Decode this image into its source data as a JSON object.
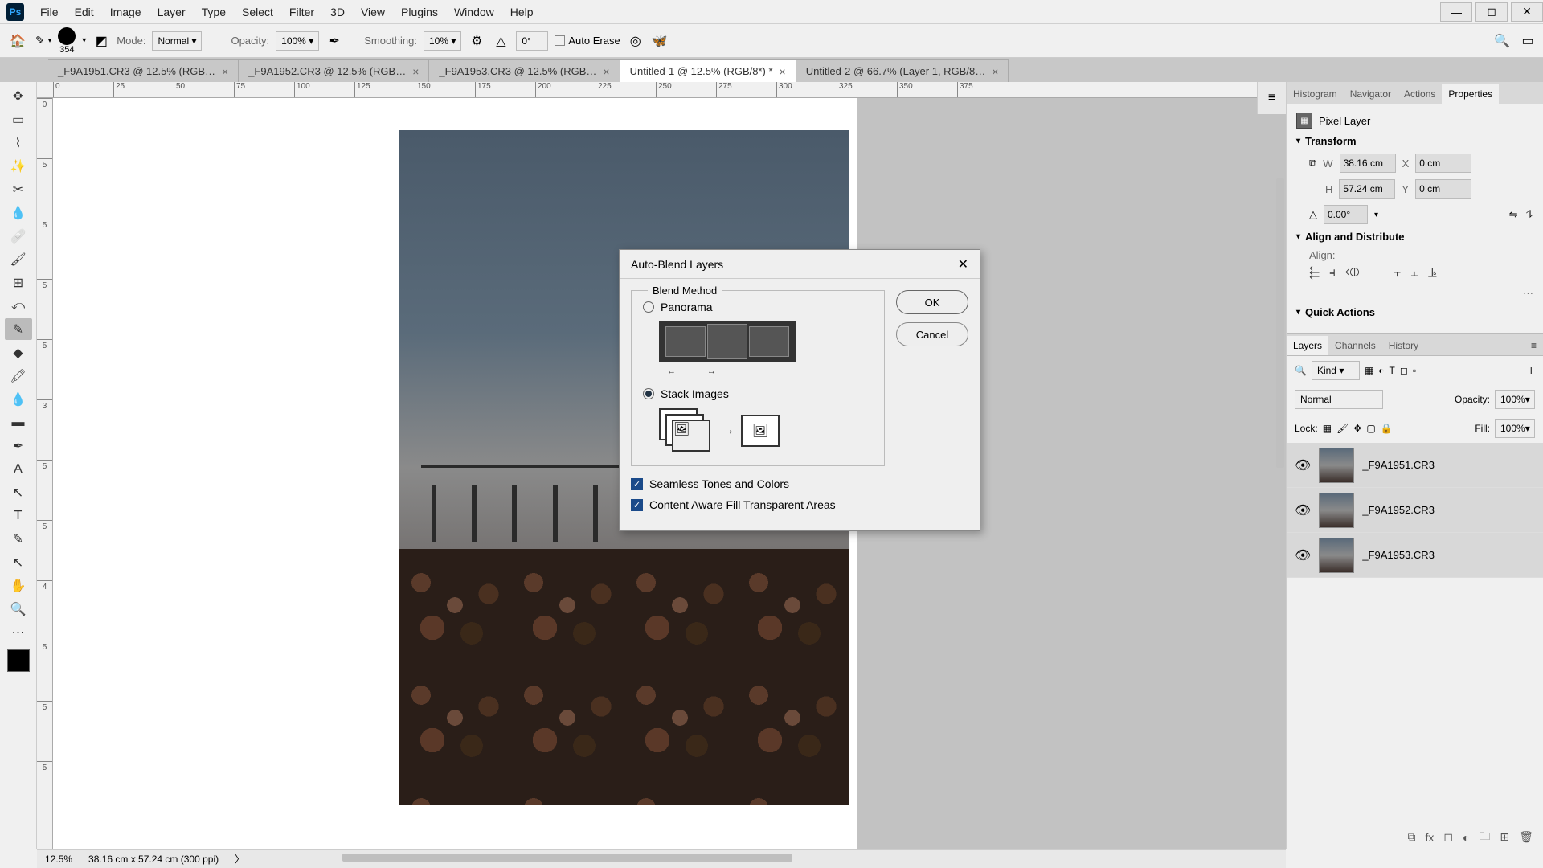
{
  "menus": [
    "File",
    "Edit",
    "Image",
    "Layer",
    "Type",
    "Select",
    "Filter",
    "3D",
    "View",
    "Plugins",
    "Window",
    "Help"
  ],
  "optbar": {
    "brush_size": "354",
    "mode_label": "Mode:",
    "mode_value": "Normal",
    "opacity_label": "Opacity:",
    "opacity_value": "100%",
    "smoothing_label": "Smoothing:",
    "smoothing_value": "10%",
    "angle_value": "0°",
    "autoerase": "Auto Erase"
  },
  "tabs": [
    "_F9A1951.CR3 @ 12.5% (RGB…",
    "_F9A1952.CR3 @ 12.5% (RGB…",
    "_F9A1953.CR3 @ 12.5% (RGB…",
    "Untitled-1 @ 12.5% (RGB/8*) *",
    "Untitled-2 @ 66.7% (Layer 1, RGB/8…"
  ],
  "active_tab": 3,
  "ruler_h": [
    "0",
    "25",
    "50",
    "75",
    "100",
    "125",
    "150",
    "175",
    "200",
    "225",
    "250",
    "275",
    "300",
    "325",
    "350",
    "375"
  ],
  "ruler_h_vis": [
    "25",
    "50",
    "75",
    "100",
    "125",
    "150",
    "175",
    "200",
    "225",
    "250",
    "275",
    "300",
    "325",
    "350",
    "375"
  ],
  "ruler_v": [
    "0",
    "5",
    "5",
    "5",
    "5",
    "3",
    "5",
    "5",
    "4",
    "5",
    "5",
    "5"
  ],
  "right_tabs_top": [
    "Histogram",
    "Navigator",
    "Actions",
    "Properties"
  ],
  "properties": {
    "title": "Pixel Layer",
    "transform": "Transform",
    "w": "38.16 cm",
    "x": "0 cm",
    "h": "57.24 cm",
    "y": "0 cm",
    "angle": "0.00°",
    "align_title": "Align and Distribute",
    "align_label": "Align:",
    "quick": "Quick Actions"
  },
  "layers_tabs": [
    "Layers",
    "Channels",
    "History"
  ],
  "layers": {
    "kind": "Kind",
    "blend": "Normal",
    "opacity_label": "Opacity:",
    "opacity": "100%",
    "lock_label": "Lock:",
    "fill_label": "Fill:",
    "fill": "100%",
    "items": [
      "_F9A1951.CR3",
      "_F9A1952.CR3",
      "_F9A1953.CR3"
    ]
  },
  "status": {
    "zoom": "12.5%",
    "dims": "38.16 cm x 57.24 cm (300 ppi)"
  },
  "dialog": {
    "title": "Auto-Blend Layers",
    "legend": "Blend Method",
    "panorama": "Panorama",
    "stack": "Stack Images",
    "seamless": "Seamless Tones and Colors",
    "caf": "Content Aware Fill Transparent Areas",
    "ok": "OK",
    "cancel": "Cancel"
  }
}
